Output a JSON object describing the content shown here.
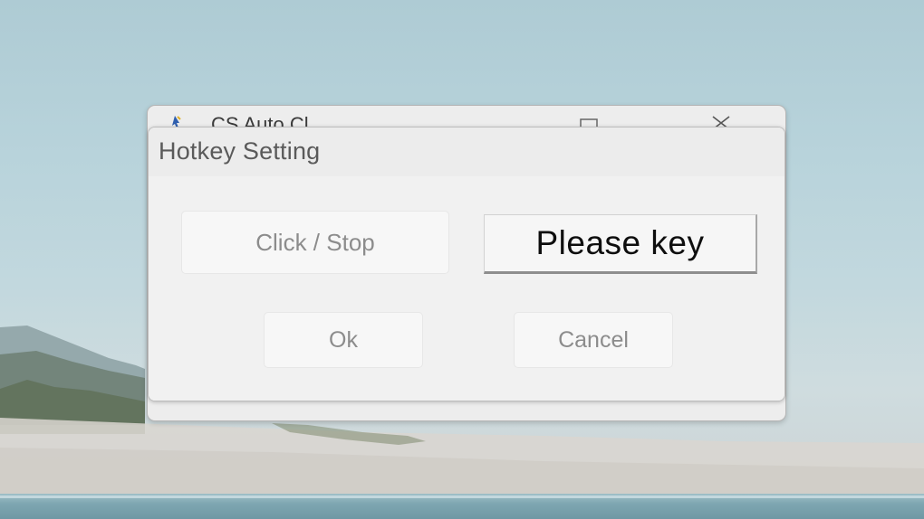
{
  "back_window": {
    "title": "CS Auto Cl...",
    "icon": "app-cursor-icon"
  },
  "dialog": {
    "title": "Hotkey Setting",
    "action_button_label": "Click / Stop",
    "key_field_value": "Please key",
    "ok_label": "Ok",
    "cancel_label": "Cancel"
  },
  "colors": {
    "dialog_background": "#f0f0f0",
    "button_background": "#f7f7f7",
    "button_text": "#8c8c8c",
    "key_text": "#0e0e0e"
  }
}
